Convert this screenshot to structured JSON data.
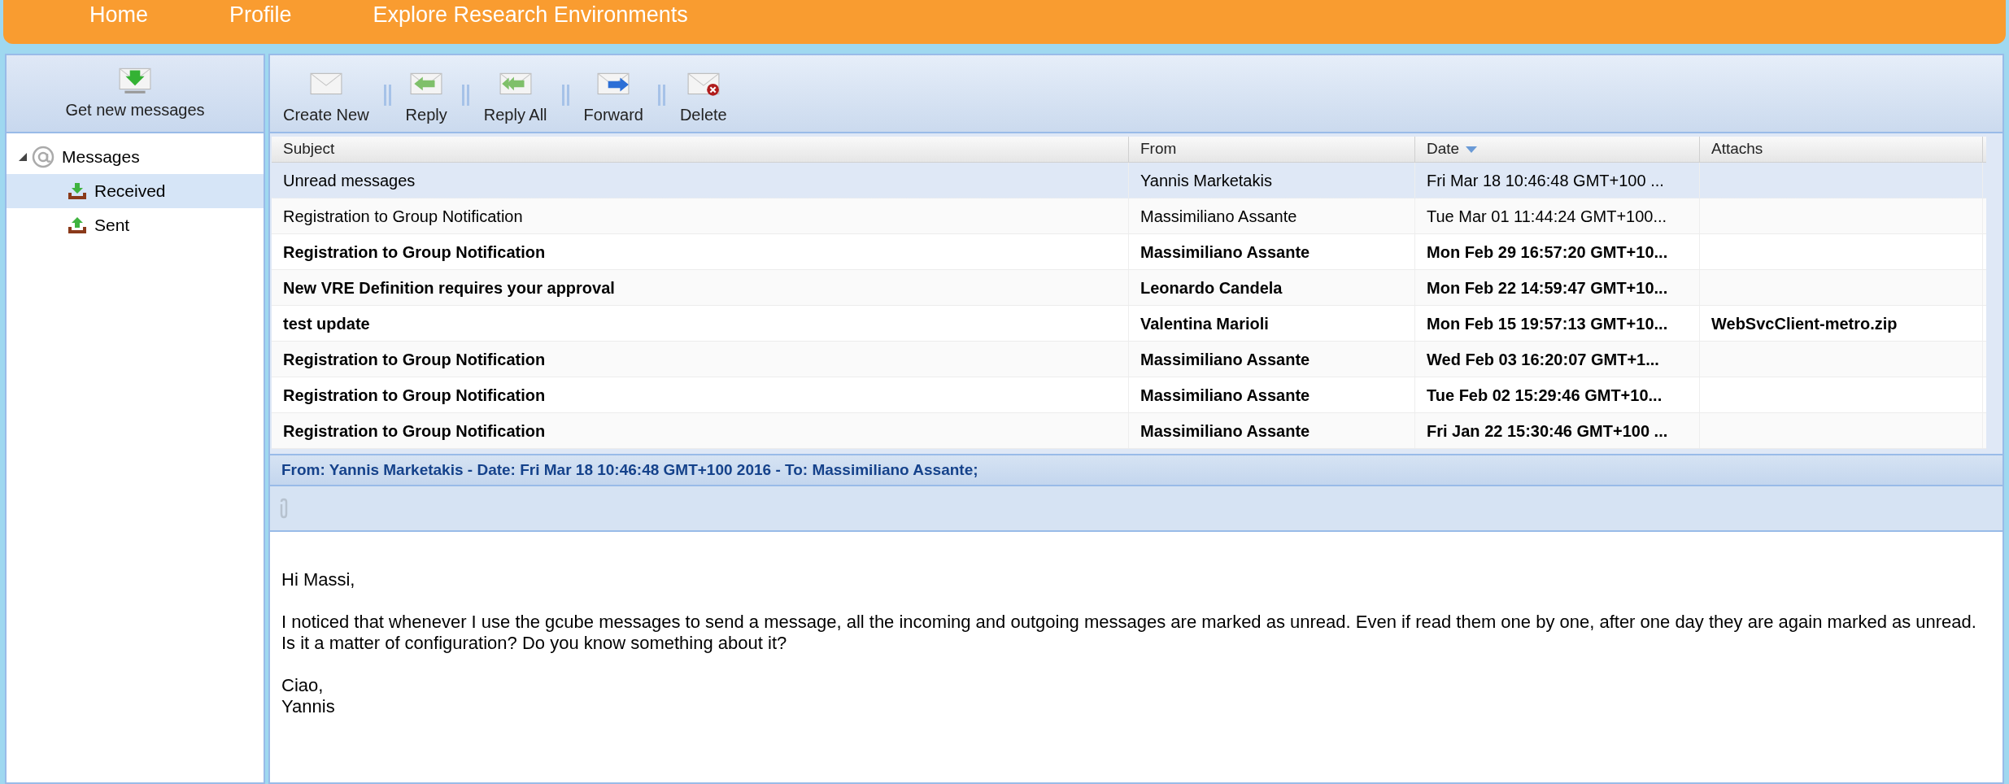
{
  "nav": [
    "Home",
    "Profile",
    "Explore Research Environments"
  ],
  "sidebar": {
    "button": "Get new messages",
    "tree": [
      {
        "label": "Messages",
        "expanded": true,
        "selected": false,
        "kind": "root",
        "children": [
          {
            "label": "Received",
            "selected": true,
            "kind": "inbox"
          },
          {
            "label": "Sent",
            "selected": false,
            "kind": "outbox"
          }
        ]
      }
    ]
  },
  "toolbar": [
    {
      "label": "Create New",
      "kind": "new"
    },
    {
      "label": "Reply",
      "kind": "reply"
    },
    {
      "label": "Reply All",
      "kind": "replyall"
    },
    {
      "label": "Forward",
      "kind": "forward"
    },
    {
      "label": "Delete",
      "kind": "delete"
    }
  ],
  "table": {
    "columns": [
      {
        "label": "Subject",
        "sorted": false
      },
      {
        "label": "From",
        "sorted": false
      },
      {
        "label": "Date",
        "sorted": true
      },
      {
        "label": "Attachs",
        "sorted": false
      }
    ],
    "rows": [
      {
        "subject": "Unread messages",
        "from": "Yannis Marketakis",
        "date": "Fri Mar 18 10:46:48 GMT+100 ...",
        "attachs": "",
        "read": true,
        "selected": true
      },
      {
        "subject": "Registration to Group Notification",
        "from": "Massimiliano Assante",
        "date": "Tue Mar 01 11:44:24 GMT+100...",
        "attachs": "",
        "read": true,
        "selected": false
      },
      {
        "subject": "Registration to Group Notification",
        "from": "Massimiliano Assante",
        "date": "Mon Feb 29 16:57:20 GMT+10...",
        "attachs": "",
        "read": false,
        "selected": false
      },
      {
        "subject": "New VRE Definition requires your approval",
        "from": "Leonardo Candela",
        "date": "Mon Feb 22 14:59:47 GMT+10...",
        "attachs": "",
        "read": false,
        "selected": false
      },
      {
        "subject": "test update",
        "from": "Valentina Marioli",
        "date": "Mon Feb 15 19:57:13 GMT+10...",
        "attachs": "WebSvcClient-metro.zip",
        "read": false,
        "selected": false
      },
      {
        "subject": "Registration to Group Notification",
        "from": "Massimiliano Assante",
        "date": "Wed Feb 03 16:20:07 GMT+1...",
        "attachs": "",
        "read": false,
        "selected": false
      },
      {
        "subject": "Registration to Group Notification",
        "from": "Massimiliano Assante",
        "date": "Tue Feb 02 15:29:46 GMT+10...",
        "attachs": "",
        "read": false,
        "selected": false
      },
      {
        "subject": "Registration to Group Notification",
        "from": "Massimiliano Assante",
        "date": "Fri Jan 22 15:30:46 GMT+100 ...",
        "attachs": "",
        "read": false,
        "selected": false
      }
    ]
  },
  "message": {
    "header": "From: Yannis Marketakis - Date: Fri Mar 18 10:46:48 GMT+100 2016 - To: Massimiliano Assante;",
    "paragraphs": [
      [
        "Hi Massi,"
      ],
      [
        "I noticed that whenever I use the gcube messages to send a message, all the incoming and outgoing messages are marked as unread. Even if read them one by one, after one day they are again marked as unread.",
        "Is it a matter of configuration? Do you know something about it?"
      ],
      [
        "Ciao,",
        "Yannis"
      ]
    ]
  }
}
